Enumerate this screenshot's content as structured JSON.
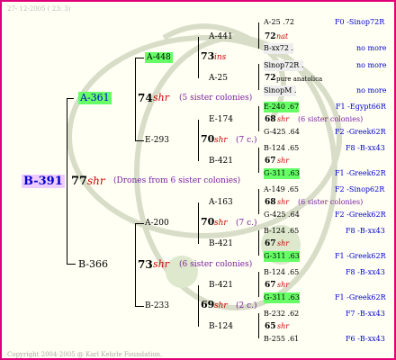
{
  "header_date": "27- 12-2005 ( 23: 3)",
  "footer": "Copyright 2004-2005 @ Karl Kehrle Foundation.",
  "root": {
    "id": "B-391",
    "year": "77",
    "race": "shr",
    "note": "(Drones from 6 sister colonies)"
  },
  "gen1": [
    {
      "id": "A-361",
      "year": "74",
      "race": "shr",
      "note": "(5 sister colonies)"
    },
    {
      "id": "B-366",
      "year": "73",
      "race": "shr",
      "note": "(6 sister colonies)"
    }
  ],
  "gen2": [
    {
      "id": "A-448",
      "year": "73",
      "race": "ins"
    },
    {
      "id": "E-293",
      "year": "70",
      "race": "shr",
      "note": "(7 c.)"
    },
    {
      "id": "A-200",
      "year": "70",
      "race": "shr",
      "note": "(7 c.)"
    },
    {
      "id": "B-233",
      "year": "69",
      "race": "shr",
      "note": "(2 c.)"
    }
  ],
  "gen3": [
    {
      "id": "A-441",
      "year": "72",
      "race": "nat"
    },
    {
      "id": "A-25",
      "year": "72",
      "race": "pure anatolica"
    },
    {
      "id": "E-174",
      "year": "68",
      "race": "shr",
      "note": "(6 sister colonies)"
    },
    {
      "id": "B-421",
      "year": "67",
      "race": "shr"
    },
    {
      "id": "A-163",
      "year": "68",
      "race": "shr",
      "note": "(6 sister colonies)"
    },
    {
      "id": "B-421",
      "year": "67",
      "race": "shr"
    },
    {
      "id": "B-421",
      "year": "67",
      "race": "shr"
    },
    {
      "id": "B-124",
      "year": "65",
      "race": "shr"
    }
  ],
  "gen4": [
    {
      "id": "A-25 .72",
      "ref": "F0 -Sinop72R"
    },
    {
      "id": "B-xx72 .",
      "ref": "no more"
    },
    {
      "id": "Sinop72R .",
      "ref": "no more"
    },
    {
      "id": "SinopM .",
      "ref": "no more"
    },
    {
      "id": "E-240 .67",
      "ref": "F1 -Egypt66R"
    },
    {
      "id": "G-425 .64",
      "ref": "F2 -Greek62R"
    },
    {
      "id": "B-124 .65",
      "ref": "F8 -B-xx43"
    },
    {
      "id": "G-311 .63",
      "ref": "F1 -Greek62R"
    },
    {
      "id": "A-149 .65",
      "ref": "F2 -Sinop62R"
    },
    {
      "id": "G-425 .64",
      "ref": "F2 -Greek62R"
    },
    {
      "id": "B-124 .65",
      "ref": "F8 -B-xx43"
    },
    {
      "id": "G-311 .63",
      "ref": "F1 -Greek62R"
    },
    {
      "id": "B-124 .65",
      "ref": "F8 -B-xx43"
    },
    {
      "id": "G-311 .63",
      "ref": "F1 -Greek62R"
    },
    {
      "id": "B-232 .62",
      "ref": "F7 -B-xx43"
    },
    {
      "id": "B-255 .61",
      "ref": "F6 -B-xx43"
    }
  ]
}
